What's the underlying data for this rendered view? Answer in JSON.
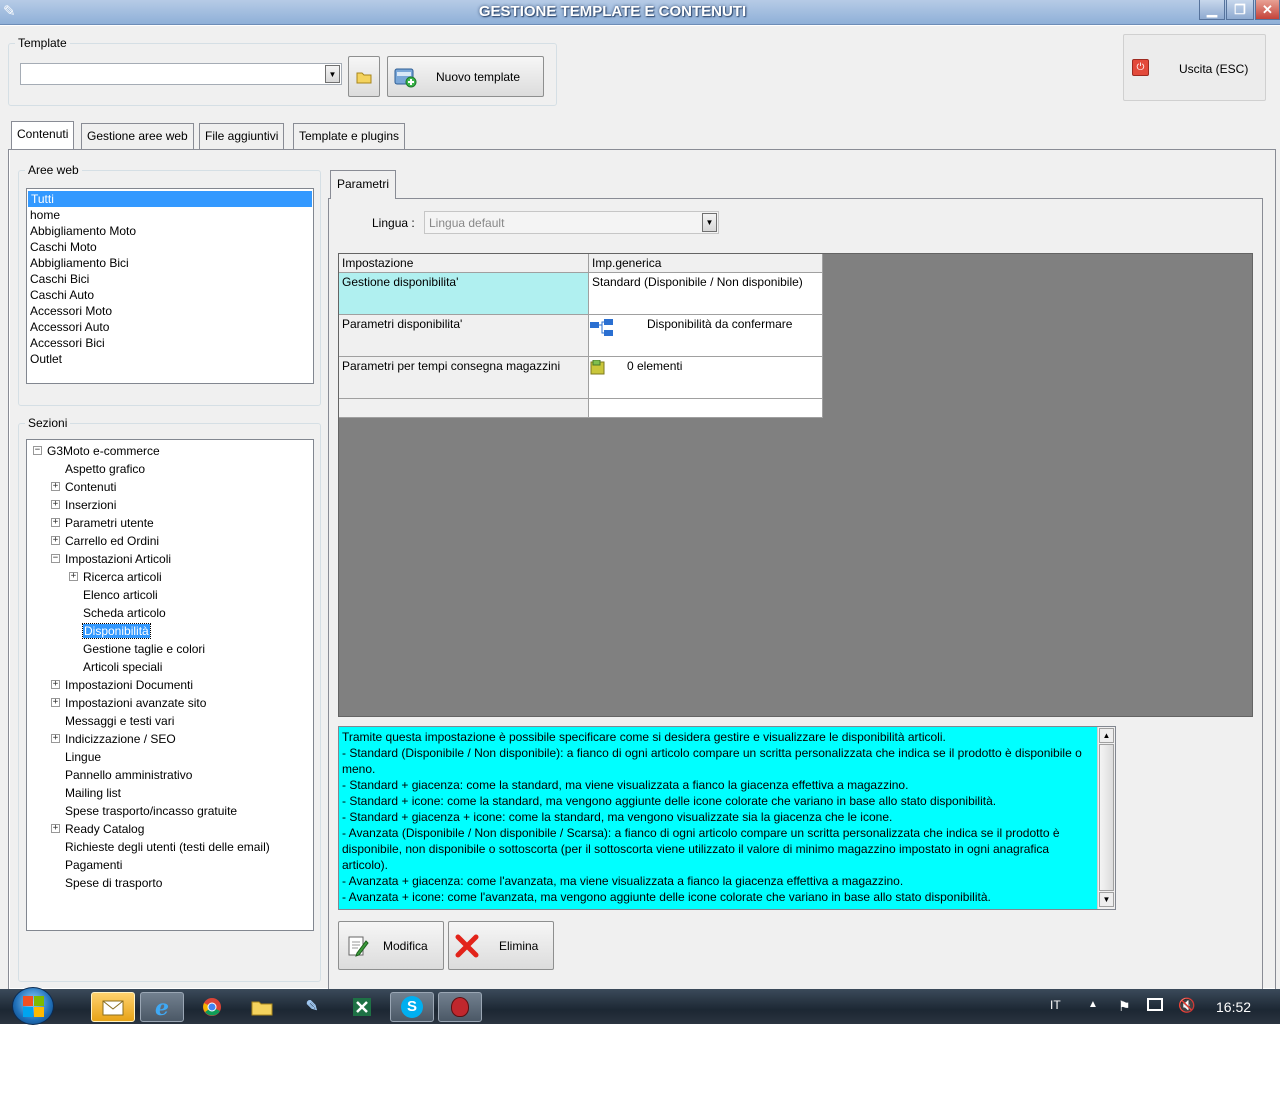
{
  "window": {
    "title": "GESTIONE TEMPLATE E CONTENUTI",
    "minimize": "▁",
    "maximize": "❐",
    "close": "✕"
  },
  "template_group": {
    "legend": "Template",
    "selected_value": "",
    "new_button_label": "Nuovo template"
  },
  "exit_button_label": "Uscita (ESC)",
  "tabs": [
    {
      "label": "Contenuti",
      "active": true
    },
    {
      "label": "Gestione aree web",
      "active": false
    },
    {
      "label": "File aggiuntivi",
      "active": false
    },
    {
      "label": "Template e plugins",
      "active": false
    }
  ],
  "aree_web": {
    "legend": "Aree web",
    "items": [
      "Tutti",
      "home",
      "Abbigliamento Moto",
      "Caschi Moto",
      "Abbigliamento Bici",
      "Caschi Bici",
      "Caschi Auto",
      "Accessori Moto",
      "Accessori Auto",
      "Accessori Bici",
      "Outlet"
    ],
    "selected_index": 0
  },
  "sezioni": {
    "legend": "Sezioni",
    "nodes": [
      {
        "label": "G3Moto e-commerce",
        "level": 0,
        "expander": "−"
      },
      {
        "label": "Aspetto grafico",
        "level": 1,
        "expander": ""
      },
      {
        "label": "Contenuti",
        "level": 1,
        "expander": "+"
      },
      {
        "label": "Inserzioni",
        "level": 1,
        "expander": "+"
      },
      {
        "label": "Parametri utente",
        "level": 1,
        "expander": "+"
      },
      {
        "label": "Carrello ed Ordini",
        "level": 1,
        "expander": "+"
      },
      {
        "label": "Impostazioni Articoli",
        "level": 1,
        "expander": "−"
      },
      {
        "label": "Ricerca articoli",
        "level": 2,
        "expander": "+"
      },
      {
        "label": "Elenco articoli",
        "level": 2,
        "expander": ""
      },
      {
        "label": "Scheda articolo",
        "level": 2,
        "expander": ""
      },
      {
        "label": "Disponibilità",
        "level": 2,
        "expander": "",
        "selected": true
      },
      {
        "label": "Gestione taglie e colori",
        "level": 2,
        "expander": ""
      },
      {
        "label": "Articoli speciali",
        "level": 2,
        "expander": ""
      },
      {
        "label": "Impostazioni Documenti",
        "level": 1,
        "expander": "+"
      },
      {
        "label": "Impostazioni avanzate sito",
        "level": 1,
        "expander": "+"
      },
      {
        "label": "Messaggi e testi vari",
        "level": 1,
        "expander": ""
      },
      {
        "label": "Indicizzazione / SEO",
        "level": 1,
        "expander": "+"
      },
      {
        "label": "Lingue",
        "level": 1,
        "expander": ""
      },
      {
        "label": "Pannello amministrativo",
        "level": 1,
        "expander": ""
      },
      {
        "label": "Mailing list",
        "level": 1,
        "expander": ""
      },
      {
        "label": "Spese trasporto/incasso gratuite",
        "level": 1,
        "expander": ""
      },
      {
        "label": "Ready Catalog",
        "level": 1,
        "expander": "+"
      },
      {
        "label": "Richieste degli utenti (testi delle email)",
        "level": 1,
        "expander": ""
      },
      {
        "label": "Pagamenti",
        "level": 1,
        "expander": ""
      },
      {
        "label": "Spese di trasporto",
        "level": 1,
        "expander": ""
      }
    ]
  },
  "parametri": {
    "tab_label": "Parametri",
    "lingua_label": "Lingua :",
    "lingua_value": "Lingua default",
    "grid": {
      "headers": [
        "Impostazione",
        "Imp.generica"
      ],
      "rows": [
        {
          "name": "Gestione disponibilita'",
          "value": "Standard (Disponibile / Non disponibile)",
          "icon": ""
        },
        {
          "name": "Parametri disponibilita'",
          "value": "Disponibilità da confermare",
          "icon": "tree-icon"
        },
        {
          "name": "Parametri per tempi consegna magazzini",
          "value": "0 elementi",
          "icon": "folder-icon"
        }
      ]
    },
    "description": [
      "Tramite questa impostazione è possibile specificare come si desidera gestire e visualizzare le disponibilità articoli.",
      "- Standard (Disponibile / Non disponibile): a fianco di ogni articolo compare un scritta personalizzata che indica se il prodotto è disponibile o meno.",
      "- Standard + giacenza: come la standard, ma viene visualizzata a fianco la giacenza effettiva a magazzino.",
      "- Standard + icone: come la standard, ma vengono aggiunte delle icone colorate che variano in base allo stato disponibilità.",
      "- Standard + giacenza + icone: come la standard, ma vengono visualizzate sia la giacenza che le icone.",
      "- Avanzata (Disponibile / Non disponibile / Scarsa): a fianco di ogni articolo compare un scritta personalizzata che indica se il prodotto è disponibile, non disponibile o sottoscorta (per il sottoscorta viene utilizzato il valore di minimo magazzino impostato in ogni anagrafica articolo).",
      "- Avanzata + giacenza: come l'avanzata, ma viene visualizzata a fianco la giacenza effettiva a magazzino.",
      "- Avanzata + icone: come l'avanzata, ma vengono aggiunte delle icone colorate che variano in base allo stato disponibilità."
    ],
    "modifica_label": "Modifica",
    "elimina_label": "Elimina"
  },
  "taskbar": {
    "language": "IT",
    "clock": "16:52"
  },
  "colors": {
    "selection": "#3399ff",
    "description_bg": "#00ffff",
    "grid_highlight": "#b0f0f0",
    "grid_bg": "#808080"
  }
}
